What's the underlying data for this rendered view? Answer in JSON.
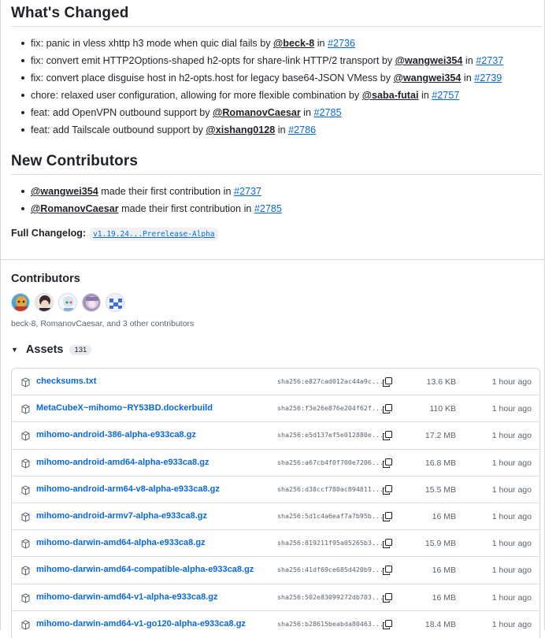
{
  "whats_changed": {
    "title": "What's Changed",
    "items": [
      {
        "text": "fix: panic in vless xhttp h3 mode when quic dial fails by ",
        "user": "@beck-8",
        "mid": " in ",
        "pr": "#2736"
      },
      {
        "text": "fix: convert emit HTTP2Options-shaped h2-opts for share-link HTTP/2 transport by ",
        "user": "@wangwei354",
        "mid": " in ",
        "pr": "#2737"
      },
      {
        "text": "fix: convert place disguise host in h2-opts.host for legacy base64-JSON VMess by ",
        "user": "@wangwei354",
        "mid": " in ",
        "pr": "#2739"
      },
      {
        "text": "chore: relaxed user configuration, allowing for more flexible combination by ",
        "user": "@saba-futai",
        "mid": " in ",
        "pr": "#2757"
      },
      {
        "text": "feat: add OpenVPN outbound support by ",
        "user": "@RomanovCaesar",
        "mid": " in ",
        "pr": "#2785"
      },
      {
        "text": "feat: add Tailscale outbound support by ",
        "user": "@xishang0128",
        "mid": " in ",
        "pr": "#2786"
      }
    ]
  },
  "new_contributors": {
    "title": "New Contributors",
    "items": [
      {
        "user": "@wangwei354",
        "text": " made their first contribution in ",
        "pr": "#2737"
      },
      {
        "user": "@RomanovCaesar",
        "text": " made their first contribution in ",
        "pr": "#2785"
      }
    ]
  },
  "changelog": {
    "label": "Full Changelog:",
    "link": "v1.19.24...Prerelease-Alpha"
  },
  "contributors": {
    "title": "Contributors",
    "summary": "beck-8, RomanovCaesar, and 3 other contributors",
    "avatars": [
      {
        "name": "beck-8",
        "color": "#e8a23a"
      },
      {
        "name": "contributor-2",
        "color": "#3b2a2a"
      },
      {
        "name": "contributor-3",
        "color": "#d9e4ef"
      },
      {
        "name": "contributor-4",
        "color": "#b7a3c4"
      },
      {
        "name": "contributor-5",
        "color": "#3b6fd4"
      }
    ]
  },
  "assets": {
    "title": "Assets",
    "count": "131",
    "rows": [
      {
        "name": "checksums.txt",
        "sha": "sha256:e827cad012ac44a9c...",
        "size": "13.6 KB",
        "time": "1 hour ago"
      },
      {
        "name": "MetaCubeX~mihomo~RY53BD.dockerbuild",
        "sha": "sha256:f3e26e876e204f62f...",
        "size": "110 KB",
        "time": "1 hour ago"
      },
      {
        "name": "mihomo-android-386-alpha-e933ca8.gz",
        "sha": "sha256:e5d137ef5e012880e...",
        "size": "17.2 MB",
        "time": "1 hour ago"
      },
      {
        "name": "mihomo-android-amd64-alpha-e933ca8.gz",
        "sha": "sha256:a67cb4f0f700e7206...",
        "size": "16.8 MB",
        "time": "1 hour ago"
      },
      {
        "name": "mihomo-android-arm64-v8-alpha-e933ca8.gz",
        "sha": "sha256:d38ccf780ac894811...",
        "size": "15.5 MB",
        "time": "1 hour ago"
      },
      {
        "name": "mihomo-android-armv7-alpha-e933ca8.gz",
        "sha": "sha256:5d1c4a6eaf7a7b95b...",
        "size": "16 MB",
        "time": "1 hour ago"
      },
      {
        "name": "mihomo-darwin-amd64-alpha-e933ca8.gz",
        "sha": "sha256:819211f95a05265b3...",
        "size": "15.9 MB",
        "time": "1 hour ago"
      },
      {
        "name": "mihomo-darwin-amd64-compatible-alpha-e933ca8.gz",
        "sha": "sha256:41df69ce685d420b9...",
        "size": "16 MB",
        "time": "1 hour ago"
      },
      {
        "name": "mihomo-darwin-amd64-v1-alpha-e933ca8.gz",
        "sha": "sha256:502e83099272db703...",
        "size": "16 MB",
        "time": "1 hour ago"
      },
      {
        "name": "mihomo-darwin-amd64-v1-go120-alpha-e933ca8.gz",
        "sha": "sha256:b28615beabda80463...",
        "size": "18.4 MB",
        "time": "1 hour ago"
      }
    ]
  }
}
